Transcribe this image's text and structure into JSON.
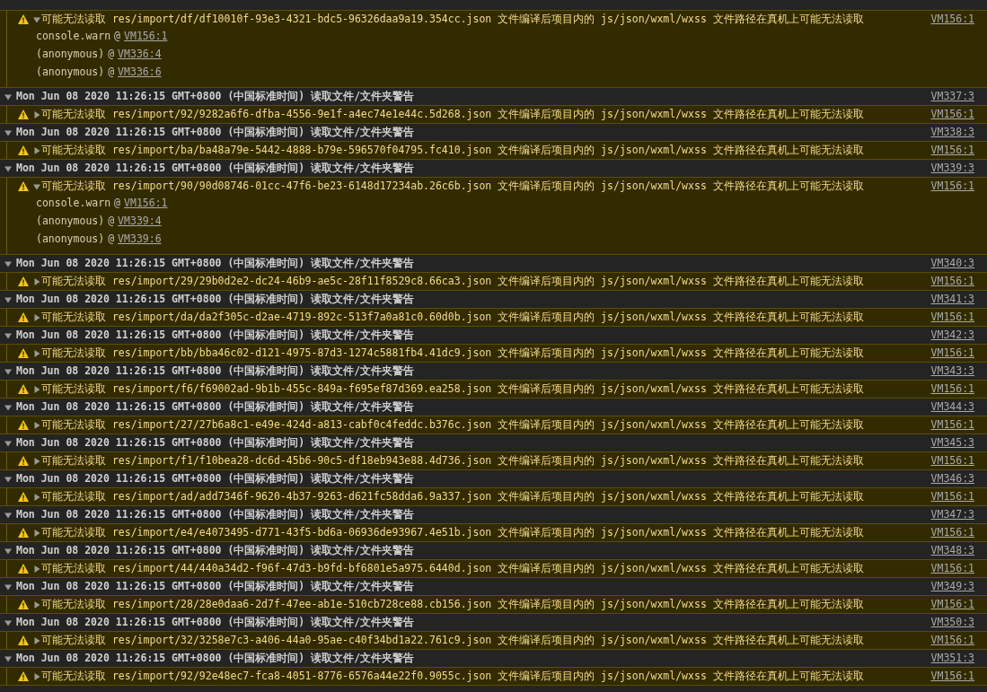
{
  "entries": [
    {
      "kind": "warning",
      "expanded": true,
      "message": "可能无法读取 res/import/df/df10010f-93e3-4321-bdc5-96326daa9a19.354cc.json 文件编译后项目内的 js/json/wxml/wxss 文件路径在真机上可能无法读取",
      "source": "VM156:1",
      "stack": [
        {
          "fn": "console.warn",
          "at": "@",
          "link": "VM156:1"
        },
        {
          "fn": "(anonymous)",
          "at": "@",
          "link": "VM336:4"
        },
        {
          "fn": "(anonymous)",
          "at": "@",
          "link": "VM336:6"
        }
      ]
    },
    {
      "kind": "group",
      "expanded": true,
      "title": "Mon Jun 08 2020 11:26:15 GMT+0800 (中国标准时间) 读取文件/文件夹警告",
      "source": "VM337:3"
    },
    {
      "kind": "warning",
      "expanded": false,
      "message": "可能无法读取 res/import/92/9282a6f6-dfba-4556-9e1f-a4ec74e1e44c.5d268.json 文件编译后项目内的 js/json/wxml/wxss 文件路径在真机上可能无法读取",
      "source": "VM156:1"
    },
    {
      "kind": "group",
      "expanded": true,
      "title": "Mon Jun 08 2020 11:26:15 GMT+0800 (中国标准时间) 读取文件/文件夹警告",
      "source": "VM338:3"
    },
    {
      "kind": "warning",
      "expanded": false,
      "message": "可能无法读取 res/import/ba/ba48a79e-5442-4888-b79e-596570f04795.fc410.json 文件编译后项目内的 js/json/wxml/wxss 文件路径在真机上可能无法读取",
      "source": "VM156:1"
    },
    {
      "kind": "group",
      "expanded": true,
      "title": "Mon Jun 08 2020 11:26:15 GMT+0800 (中国标准时间) 读取文件/文件夹警告",
      "source": "VM339:3"
    },
    {
      "kind": "warning",
      "expanded": true,
      "message": "可能无法读取 res/import/90/90d08746-01cc-47f6-be23-6148d17234ab.26c6b.json 文件编译后项目内的 js/json/wxml/wxss 文件路径在真机上可能无法读取",
      "source": "VM156:1",
      "stack": [
        {
          "fn": "console.warn",
          "at": "@",
          "link": "VM156:1"
        },
        {
          "fn": "(anonymous)",
          "at": "@",
          "link": "VM339:4"
        },
        {
          "fn": "(anonymous)",
          "at": "@",
          "link": "VM339:6"
        }
      ]
    },
    {
      "kind": "group",
      "expanded": true,
      "title": "Mon Jun 08 2020 11:26:15 GMT+0800 (中国标准时间) 读取文件/文件夹警告",
      "source": "VM340:3"
    },
    {
      "kind": "warning",
      "expanded": false,
      "message": "可能无法读取 res/import/29/29b0d2e2-dc24-46b9-ae5c-28f11f8529c8.66ca3.json 文件编译后项目内的 js/json/wxml/wxss 文件路径在真机上可能无法读取",
      "source": "VM156:1"
    },
    {
      "kind": "group",
      "expanded": true,
      "title": "Mon Jun 08 2020 11:26:15 GMT+0800 (中国标准时间) 读取文件/文件夹警告",
      "source": "VM341:3"
    },
    {
      "kind": "warning",
      "expanded": false,
      "message": "可能无法读取 res/import/da/da2f305c-d2ae-4719-892c-513f7a0a81c0.60d0b.json 文件编译后项目内的 js/json/wxml/wxss 文件路径在真机上可能无法读取",
      "source": "VM156:1"
    },
    {
      "kind": "group",
      "expanded": true,
      "title": "Mon Jun 08 2020 11:26:15 GMT+0800 (中国标准时间) 读取文件/文件夹警告",
      "source": "VM342:3"
    },
    {
      "kind": "warning",
      "expanded": false,
      "message": "可能无法读取 res/import/bb/bba46c02-d121-4975-87d3-1274c5881fb4.41dc9.json 文件编译后项目内的 js/json/wxml/wxss 文件路径在真机上可能无法读取",
      "source": "VM156:1"
    },
    {
      "kind": "group",
      "expanded": true,
      "title": "Mon Jun 08 2020 11:26:15 GMT+0800 (中国标准时间) 读取文件/文件夹警告",
      "source": "VM343:3"
    },
    {
      "kind": "warning",
      "expanded": false,
      "message": "可能无法读取 res/import/f6/f69002ad-9b1b-455c-849a-f695ef87d369.ea258.json 文件编译后项目内的 js/json/wxml/wxss 文件路径在真机上可能无法读取",
      "source": "VM156:1"
    },
    {
      "kind": "group",
      "expanded": true,
      "title": "Mon Jun 08 2020 11:26:15 GMT+0800 (中国标准时间) 读取文件/文件夹警告",
      "source": "VM344:3"
    },
    {
      "kind": "warning",
      "expanded": false,
      "message": "可能无法读取 res/import/27/27b6a8c1-e49e-424d-a813-cabf0c4feddc.b376c.json 文件编译后项目内的 js/json/wxml/wxss 文件路径在真机上可能无法读取",
      "source": "VM156:1"
    },
    {
      "kind": "group",
      "expanded": true,
      "title": "Mon Jun 08 2020 11:26:15 GMT+0800 (中国标准时间) 读取文件/文件夹警告",
      "source": "VM345:3"
    },
    {
      "kind": "warning",
      "expanded": false,
      "message": "可能无法读取 res/import/f1/f10bea28-dc6d-45b6-90c5-df18eb943e88.4d736.json 文件编译后项目内的 js/json/wxml/wxss 文件路径在真机上可能无法读取",
      "source": "VM156:1"
    },
    {
      "kind": "group",
      "expanded": true,
      "title": "Mon Jun 08 2020 11:26:15 GMT+0800 (中国标准时间) 读取文件/文件夹警告",
      "source": "VM346:3"
    },
    {
      "kind": "warning",
      "expanded": false,
      "message": "可能无法读取 res/import/ad/add7346f-9620-4b37-9263-d621fc58dda6.9a337.json 文件编译后项目内的 js/json/wxml/wxss 文件路径在真机上可能无法读取",
      "source": "VM156:1"
    },
    {
      "kind": "group",
      "expanded": true,
      "title": "Mon Jun 08 2020 11:26:15 GMT+0800 (中国标准时间) 读取文件/文件夹警告",
      "source": "VM347:3"
    },
    {
      "kind": "warning",
      "expanded": false,
      "message": "可能无法读取 res/import/e4/e4073495-d771-43f5-bd6a-06936de93967.4e51b.json 文件编译后项目内的 js/json/wxml/wxss 文件路径在真机上可能无法读取",
      "source": "VM156:1"
    },
    {
      "kind": "group",
      "expanded": true,
      "title": "Mon Jun 08 2020 11:26:15 GMT+0800 (中国标准时间) 读取文件/文件夹警告",
      "source": "VM348:3"
    },
    {
      "kind": "warning",
      "expanded": false,
      "message": "可能无法读取 res/import/44/440a34d2-f96f-47d3-b9fd-bf6801e5a975.6440d.json 文件编译后项目内的 js/json/wxml/wxss 文件路径在真机上可能无法读取",
      "source": "VM156:1"
    },
    {
      "kind": "group",
      "expanded": true,
      "title": "Mon Jun 08 2020 11:26:15 GMT+0800 (中国标准时间) 读取文件/文件夹警告",
      "source": "VM349:3"
    },
    {
      "kind": "warning",
      "expanded": false,
      "message": "可能无法读取 res/import/28/28e0daa6-2d7f-47ee-ab1e-510cb728ce88.cb156.json 文件编译后项目内的 js/json/wxml/wxss 文件路径在真机上可能无法读取",
      "source": "VM156:1"
    },
    {
      "kind": "group",
      "expanded": true,
      "title": "Mon Jun 08 2020 11:26:15 GMT+0800 (中国标准时间) 读取文件/文件夹警告",
      "source": "VM350:3"
    },
    {
      "kind": "warning",
      "expanded": false,
      "message": "可能无法读取 res/import/32/3258e7c3-a406-44a0-95ae-c40f34bd1a22.761c9.json 文件编译后项目内的 js/json/wxml/wxss 文件路径在真机上可能无法读取",
      "source": "VM156:1"
    },
    {
      "kind": "group",
      "expanded": true,
      "title": "Mon Jun 08 2020 11:26:15 GMT+0800 (中国标准时间) 读取文件/文件夹警告",
      "source": "VM351:3"
    },
    {
      "kind": "warning",
      "expanded": false,
      "message": "可能无法读取 res/import/92/92e48ec7-fca8-4051-8776-6576a44e22f0.9055c.json 文件编译后项目内的 js/json/wxml/wxss 文件路径在真机上可能无法读取",
      "source": "VM156:1"
    }
  ]
}
